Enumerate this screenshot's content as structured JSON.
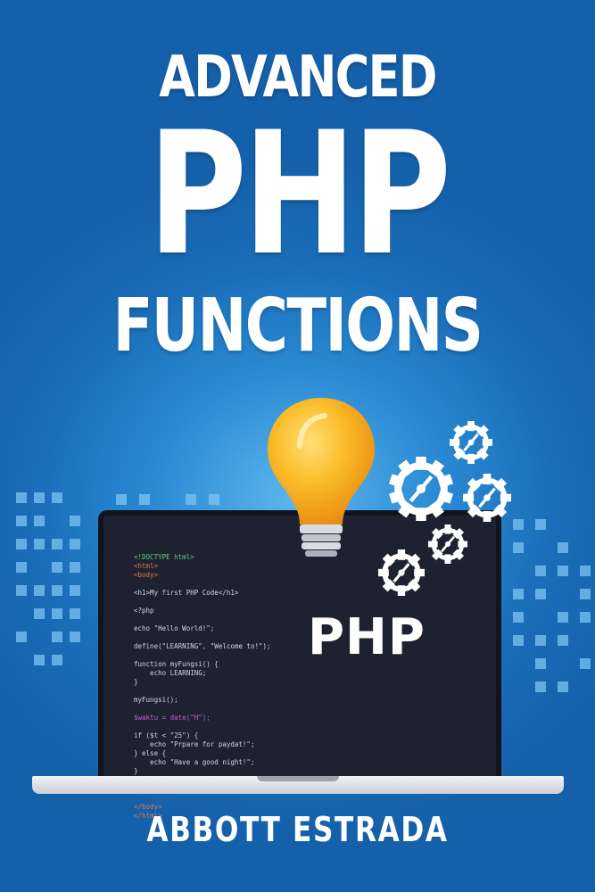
{
  "cover": {
    "title_line1": "ADVANCED",
    "title_line2": "PHP",
    "title_line3": "FUNCTIONS",
    "screen_label": "PHP",
    "author": "ABBOTT ESTRADA"
  },
  "code_lines": [
    "<!DOCTYPE html>",
    "<html>",
    "<body>",
    "",
    "<h1>My first PHP Code</h1>",
    "",
    "<?php",
    "",
    "echo \"Hello World!\";",
    "",
    "define(\"LEARNING\", \"Welcome to!\");",
    "",
    "function myFungsi() {",
    "    echo LEARNING;",
    "}",
    "",
    "myFungsi();",
    "",
    "$waktu = date(\"H\");",
    "",
    "if ($t < \"25\") {",
    "    echo \"Prpare for paydat!\";",
    "} else {",
    "    echo \"Have a good night!\";",
    "}",
    "",
    "?>",
    "",
    "</body>",
    "</html>"
  ],
  "colors": {
    "background": "#1a6db8",
    "screen": "#1e2230",
    "bulb": "#f7a81b",
    "gear": "#ffffff",
    "pixel_squares": "#7cc4f0"
  }
}
